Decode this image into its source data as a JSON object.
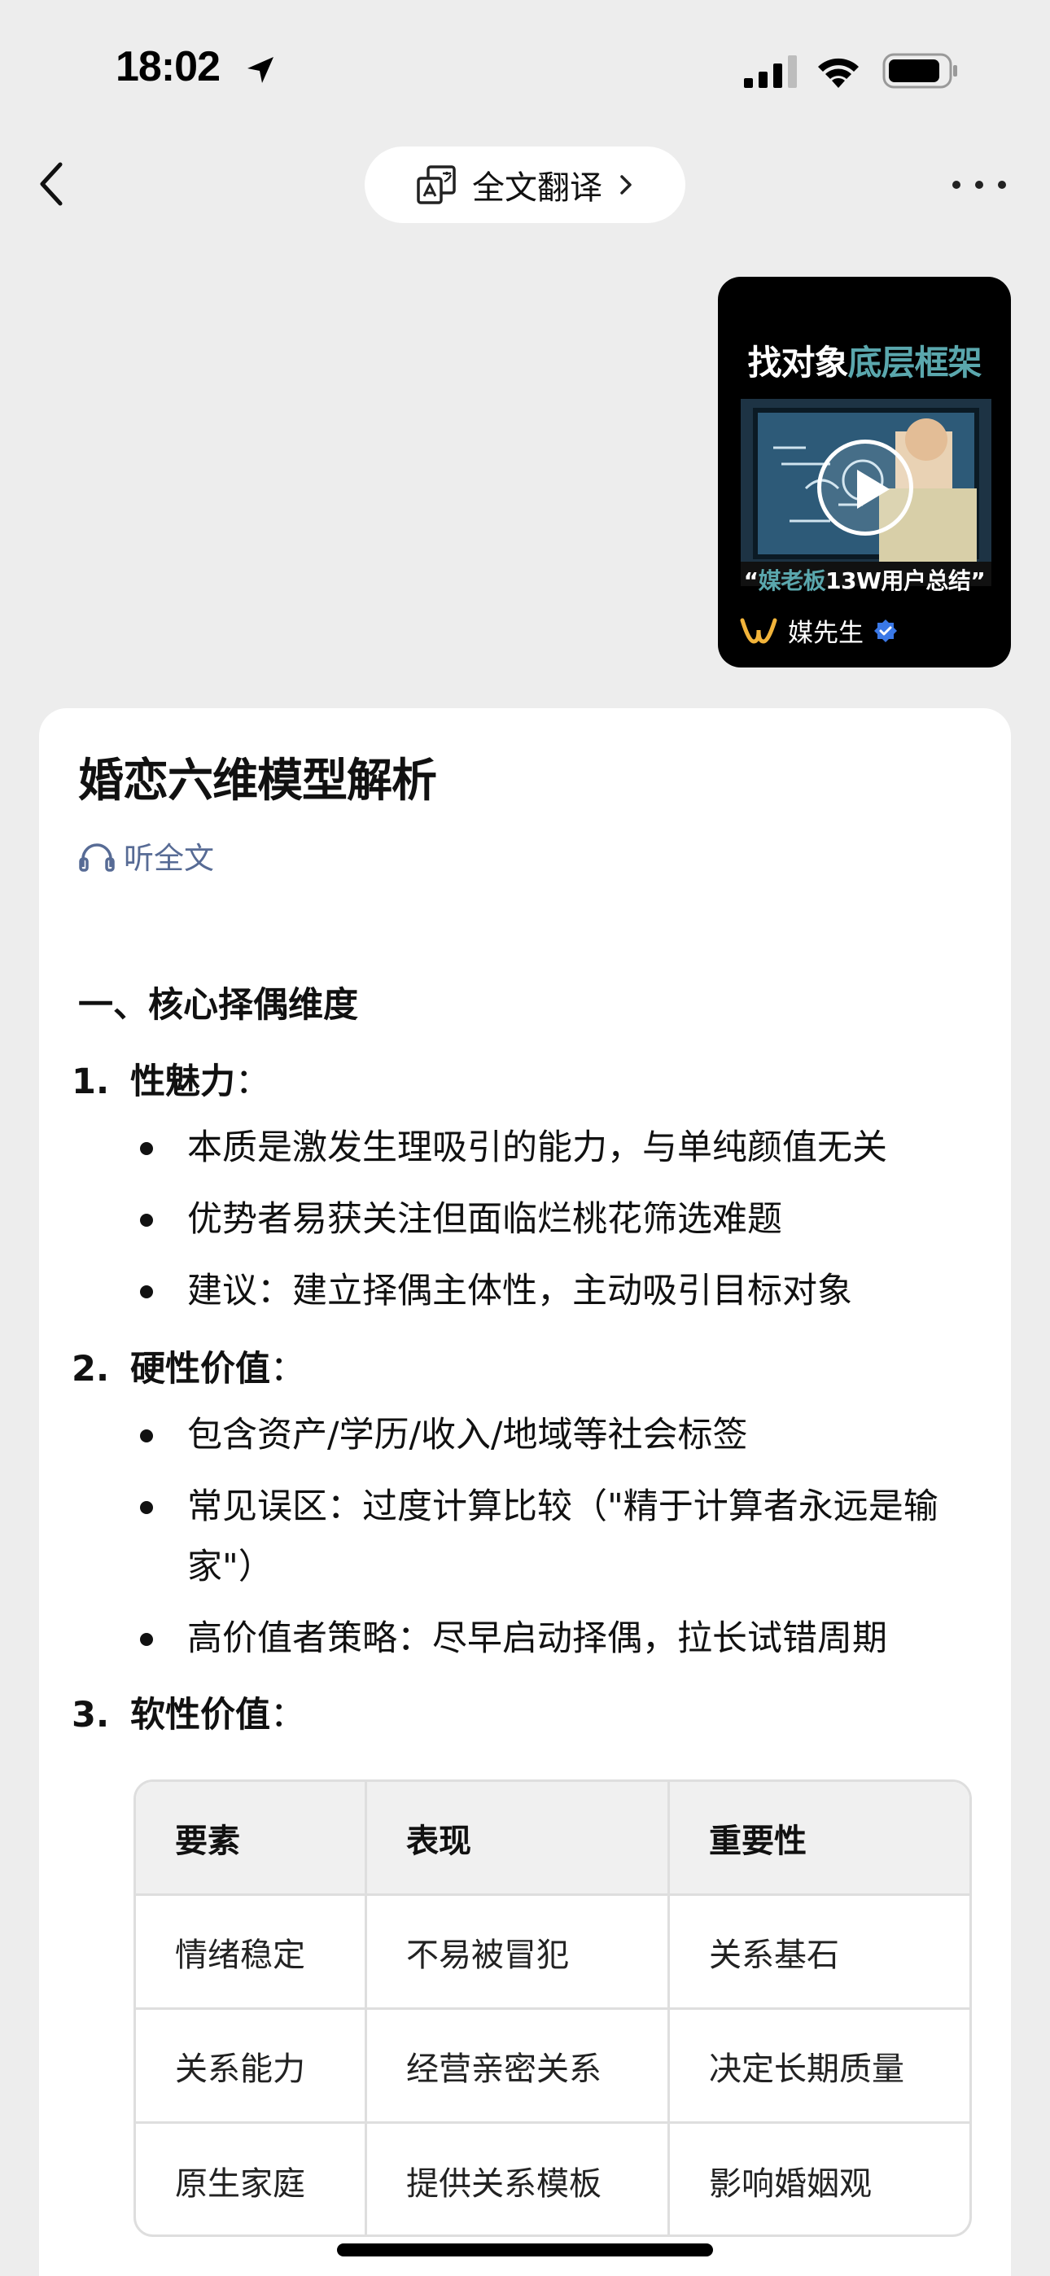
{
  "status_bar": {
    "time": "18:02",
    "icons": [
      "location-arrow-icon",
      "cellular-signal-icon",
      "wifi-icon",
      "battery-icon"
    ]
  },
  "nav": {
    "back_icon": "chevron-left-icon",
    "translate_label": "全文翻译",
    "translate_icon": "translate-icon",
    "more_icon": "more-dots-icon"
  },
  "media_card": {
    "title_part1": "找对象",
    "title_part2": "底层框架",
    "caption_open_quote": "“",
    "caption_highlight": "媒老板",
    "caption_rest": "13W用户总结”",
    "brand_name": "媒先生",
    "accent_color": "#5aa7ad"
  },
  "article": {
    "title": "婚恋六维模型解析",
    "listen_label": "听全文",
    "section_heading": "一、核心择偶维度",
    "items": [
      {
        "number": "1.",
        "title": "性魅力",
        "colon": "：",
        "bullets": [
          "本质是激发生理吸引的能力，与单纯颜值无关",
          "优势者易获关注但面临烂桃花筛选难题",
          "建议：建立择偶主体性，主动吸引目标对象"
        ]
      },
      {
        "number": "2.",
        "title": "硬性价值",
        "colon": "：",
        "bullets": [
          "包含资产/学历/收入/地域等社会标签",
          "常见误区：过度计算比较（\"精于计算者永远是输家\"）",
          "高价值者策略：尽早启动择偶，拉长试错周期"
        ]
      },
      {
        "number": "3.",
        "title": "软性价值",
        "colon": "："
      }
    ],
    "table": {
      "headers": [
        "要素",
        "表现",
        "重要性"
      ],
      "rows": [
        [
          "情绪稳定",
          "不易被冒犯",
          "关系基石"
        ],
        [
          "关系能力",
          "经营亲密关系",
          "决定长期质量"
        ],
        [
          "原生家庭",
          "提供关系模板",
          "影响婚姻观"
        ]
      ]
    }
  },
  "colors": {
    "background": "#ededed",
    "link": "#576b95",
    "verified": "#3a78e7"
  }
}
